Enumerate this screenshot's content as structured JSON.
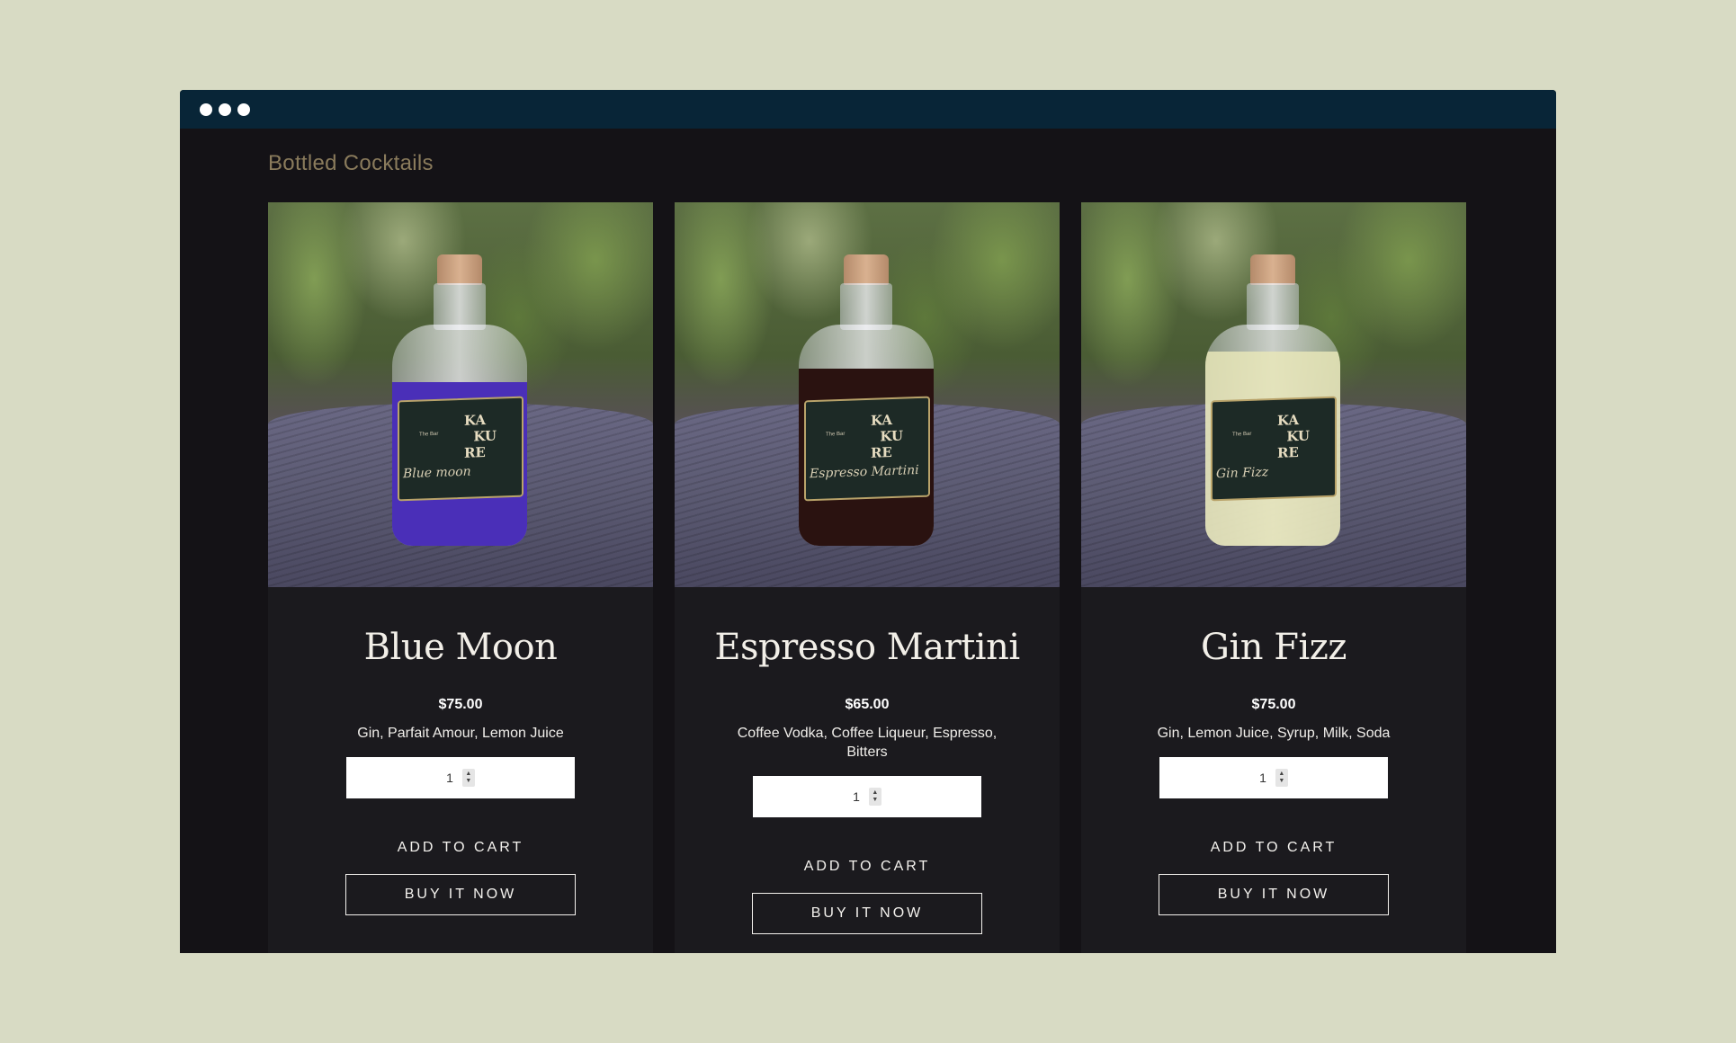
{
  "window": {
    "titlebar_color": "#082537"
  },
  "section": {
    "title": "Bottled Cocktails"
  },
  "products": [
    {
      "name": "Blue Moon",
      "price": "$75.00",
      "ingredients": "Gin, Parfait Amour, Lemon Juice",
      "quantity": "1",
      "add_to_cart": "ADD TO CART",
      "buy_now": "BUY IT NOW",
      "liquid_color": "#4a2fb8",
      "label_brand": "KA\n  KU\nRE",
      "label_script": "Blue moon",
      "label_tiny": "The Bar"
    },
    {
      "name": "Espresso Martini",
      "price": "$65.00",
      "ingredients": "Coffee Vodka, Coffee Liqueur, Espresso, Bitters",
      "quantity": "1",
      "add_to_cart": "ADD TO CART",
      "buy_now": "BUY IT NOW",
      "liquid_color": "#2a1210",
      "label_brand": "KA\n  KU\nRE",
      "label_script": "Espresso Martini",
      "label_tiny": "The Bar"
    },
    {
      "name": "Gin Fizz",
      "price": "$75.00",
      "ingredients": "Gin, Lemon Juice, Syrup, Milk, Soda",
      "quantity": "1",
      "add_to_cart": "ADD TO CART",
      "buy_now": "BUY IT NOW",
      "liquid_color": "#e8e6b8",
      "label_brand": "KA\n  KU\nRE",
      "label_script": "Gin Fizz",
      "label_tiny": "The Bar"
    }
  ]
}
